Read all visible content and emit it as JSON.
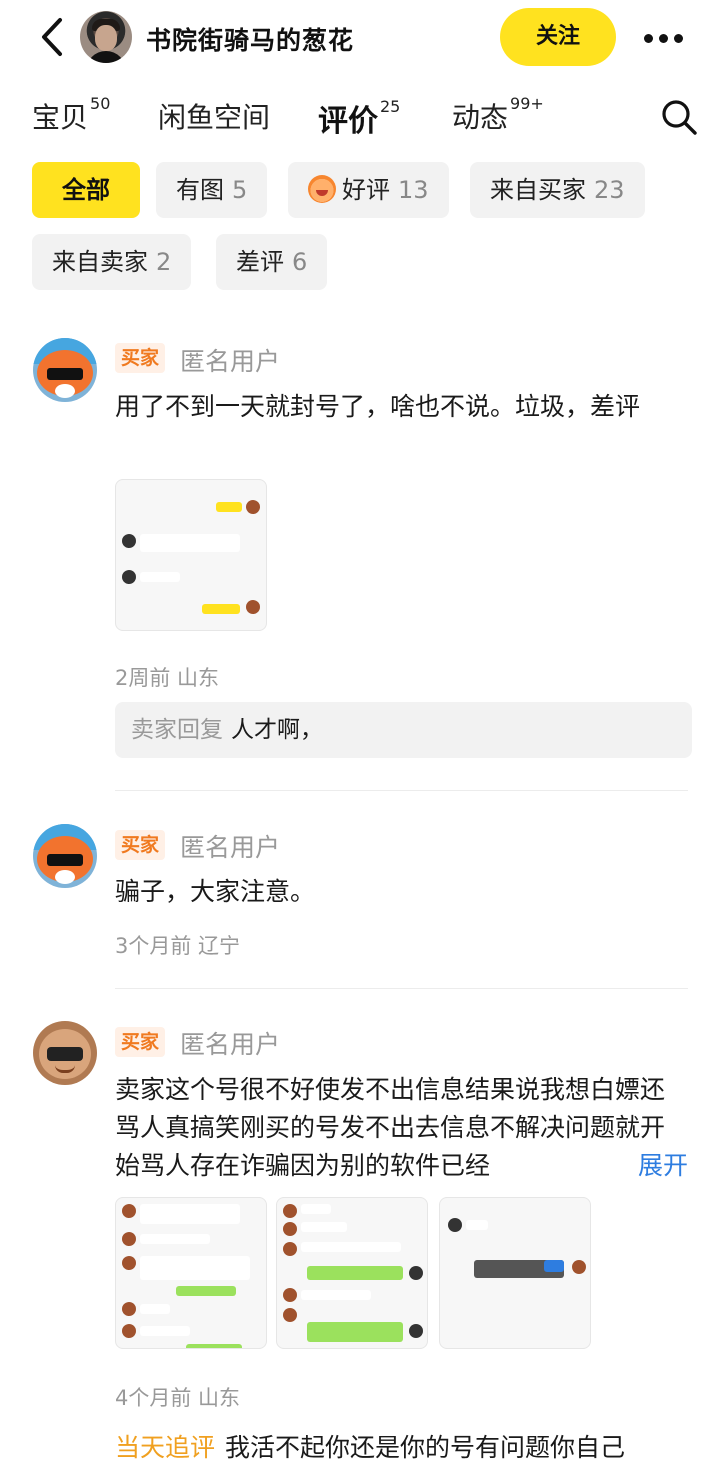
{
  "header": {
    "shop_name": "书院街骑马的葱花",
    "follow_label": "关注"
  },
  "tabs": [
    {
      "label": "宝贝",
      "count": "50"
    },
    {
      "label": "闲鱼空间",
      "count": ""
    },
    {
      "label": "评价",
      "count": "25"
    },
    {
      "label": "动态",
      "count": "99+"
    }
  ],
  "filters": [
    {
      "label": "全部",
      "count": ""
    },
    {
      "label": "有图",
      "count": "5"
    },
    {
      "label": "好评",
      "count": "13"
    },
    {
      "label": "来自买家",
      "count": "23"
    },
    {
      "label": "来自卖家",
      "count": "2"
    },
    {
      "label": "差评",
      "count": "6"
    }
  ],
  "reviews": [
    {
      "badge": "买家",
      "name": "匿名用户",
      "text": "用了不到一天就封号了，啥也不说。垃圾，差评",
      "meta": "2周前  山东",
      "reply_label": "卖家回复",
      "reply_text": "人才啊，"
    },
    {
      "badge": "买家",
      "name": "匿名用户",
      "text": "骗子，大家注意。",
      "meta": "3个月前  辽宁"
    },
    {
      "badge": "买家",
      "name": "匿名用户",
      "text": "卖家这个号很不好使发不出信息结果说我想白嫖还骂人真搞笑刚买的号发不出去信息不解决问题就开始骂人存在诈骗因为别的软件已经",
      "expand_label": "展开",
      "meta": "4个月前  山东",
      "followup_label": "当天追评",
      "followup_text": "我活不起你还是你的号有问题你自己"
    }
  ],
  "icons": {
    "back": "chevron-left-icon",
    "more": "more-dots-icon",
    "search": "search-icon"
  },
  "colors": {
    "accent": "#ffe21f",
    "buyer_badge": "#f07a20",
    "link": "#2e7de0"
  }
}
